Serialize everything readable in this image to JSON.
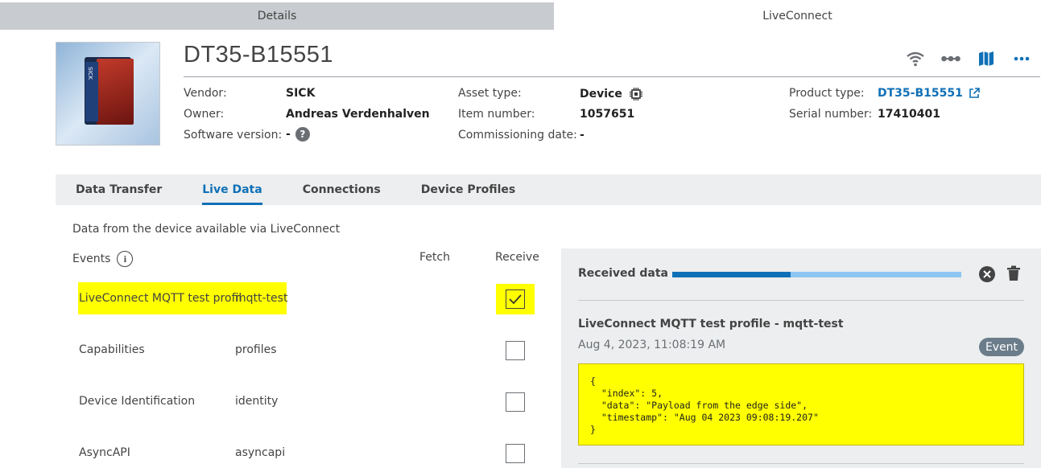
{
  "top_tabs": [
    {
      "label": "Details",
      "active": false
    },
    {
      "label": "LiveConnect",
      "active": true
    }
  ],
  "device": {
    "image_label": "SICK",
    "title": "DT35-B15551",
    "vendor_label": "Vendor:",
    "vendor": "SICK",
    "owner_label": "Owner:",
    "owner": "Andreas Verdenhalven",
    "software_label": "Software version:",
    "software": "-",
    "asset_type_label": "Asset type:",
    "asset_type": "Device",
    "item_number_label": "Item number:",
    "item_number": "1057651",
    "commissioning_label": "Commissioning date:",
    "commissioning": "-",
    "product_type_label": "Product type:",
    "product_type": "DT35-B15551",
    "serial_label": "Serial number:",
    "serial": "17410401"
  },
  "header_icons": [
    "wifi-icon",
    "connections-icon",
    "map-icon",
    "more-icon"
  ],
  "sub_tabs": [
    {
      "label": "Data Transfer",
      "active": false
    },
    {
      "label": "Live Data",
      "active": true
    },
    {
      "label": "Connections",
      "active": false
    },
    {
      "label": "Device Profiles",
      "active": false
    }
  ],
  "live_data": {
    "description": "Data from the device available via LiveConnect",
    "events_label": "Events",
    "fetch_label": "Fetch",
    "receive_label": "Receive",
    "rows": [
      {
        "name": "LiveConnect MQTT test profil",
        "topic": "mqtt-test",
        "receive": true
      },
      {
        "name": "Capabilities",
        "topic": "profiles",
        "receive": false
      },
      {
        "name": "Device Identification",
        "topic": "identity",
        "receive": false
      },
      {
        "name": "AsyncAPI",
        "topic": "asyncapi",
        "receive": false
      }
    ]
  },
  "received": {
    "title": "Received data",
    "progress": 0.41,
    "message_title": "LiveConnect MQTT test profile - mqtt-test",
    "message_time": "Aug 4, 2023, 11:08:19 AM",
    "badge": "Event",
    "payload": "{\n  \"index\": 5,\n  \"data\": \"Payload from the edge side\",\n  \"timestamp\": \"Aug 04 2023 09:08:19.207\"\n}"
  },
  "colors": {
    "accent": "#0f70b7",
    "highlight": "#ffff00",
    "panel_bg": "#eceeef"
  }
}
